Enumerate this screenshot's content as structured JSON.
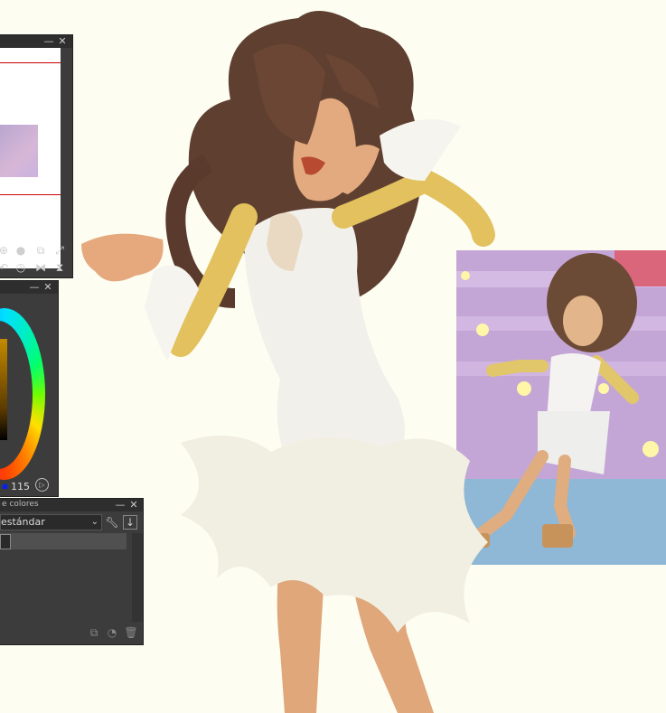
{
  "navigator": {
    "minimize_glyph": "—",
    "close_glyph": "✕"
  },
  "color_wheel": {
    "value_label": "115"
  },
  "color_set": {
    "title": "e colores",
    "dropdown_value": "estándar"
  },
  "colors": {
    "canvas_bg": "#fdfdf2",
    "panel_bg": "#3c3c3c",
    "accent_red": "#cc0000"
  },
  "icons": {
    "navigator_tools": [
      "zoom-in-icon",
      "stop-icon",
      "fit-icon",
      "fill-icon",
      "rotate-left-icon",
      "rotate-reset-icon",
      "flip-horizontal-icon",
      "flip-vertical-icon"
    ],
    "color_set_tools": [
      "wrench-icon",
      "import-icon"
    ],
    "color_set_bottom": [
      "copy-icon",
      "add-color-icon",
      "trash-icon"
    ]
  }
}
